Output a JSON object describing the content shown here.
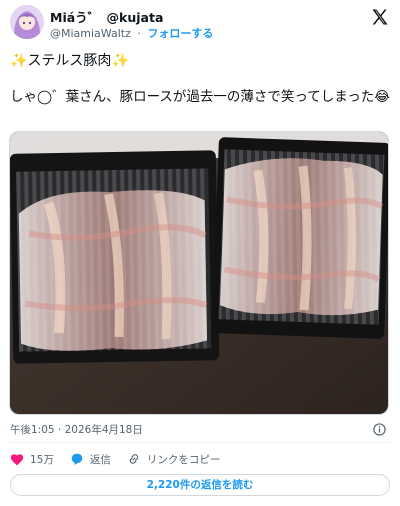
{
  "author": {
    "display_name": "Miá",
    "display_name_suffix": "う゛",
    "handle_in_name": "@kujata",
    "handle": "@MiamiaWaltz",
    "separator": "·",
    "follow_label": "フォローする"
  },
  "tweet": {
    "title_prefix": "✨",
    "title": "ステルス豚肉",
    "title_suffix": "✨",
    "body": "しゃ◯゛葉さん、豚ロースが過去一の薄さで笑ってしまった😂"
  },
  "meta": {
    "timestamp": "午後1:05 · 2026年4月18日"
  },
  "actions": {
    "like_count": "15万",
    "reply_label": "返信",
    "copy_link_label": "リンクをコピー"
  },
  "read_replies_label": "2,220件の返信を読む",
  "colors": {
    "accent": "#1d9bf0",
    "like": "#f91880",
    "muted": "#536471"
  },
  "icons": [
    "x-logo-icon",
    "info-icon",
    "heart-icon",
    "reply-icon",
    "link-icon",
    "avatar"
  ]
}
